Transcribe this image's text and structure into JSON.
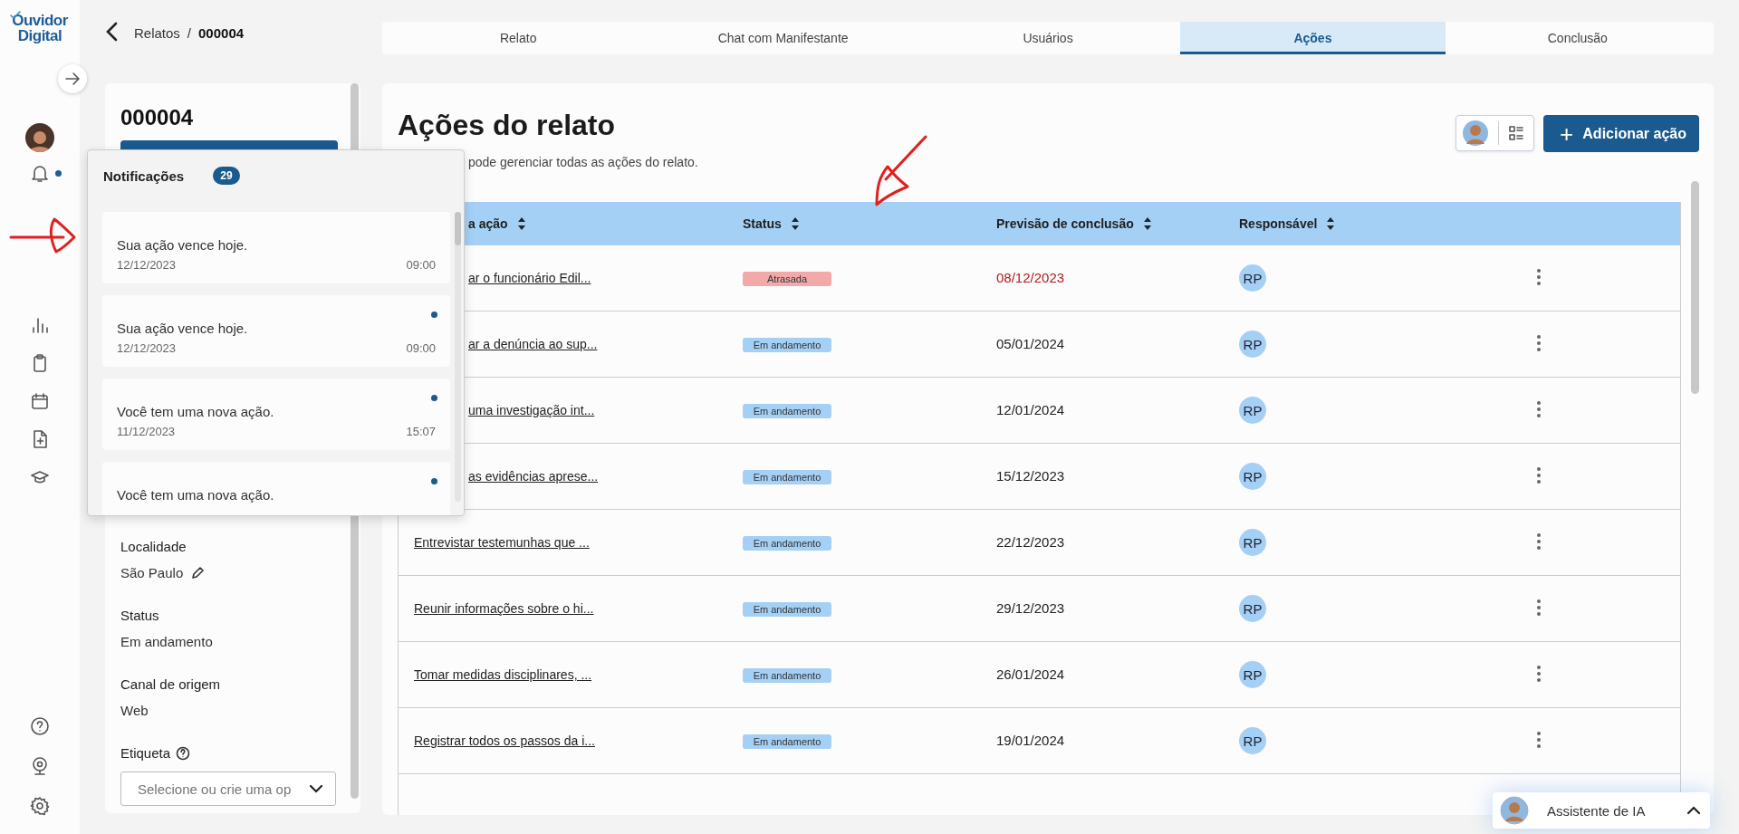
{
  "rail": {
    "logo": "Ouvidor Digital",
    "bell_unread": true
  },
  "breadcrumb": {
    "parent": "Relatos",
    "separator": "/",
    "current": "000004"
  },
  "tabs": [
    {
      "label": "Relato",
      "selected": false
    },
    {
      "label": "Chat com Manifestante",
      "selected": false
    },
    {
      "label": "Usuários",
      "selected": false
    },
    {
      "label": "Ações",
      "selected": true
    },
    {
      "label": "Conclusão",
      "selected": false
    }
  ],
  "case_card": {
    "title": "000004",
    "fields": [
      {
        "label": "Localidade",
        "value": "São Paulo",
        "editable": true
      },
      {
        "label": "Status",
        "value": "Em andamento"
      },
      {
        "label": "Canal de origem",
        "value": "Web"
      }
    ],
    "tag_field": {
      "label": "Etiqueta",
      "placeholder": "Selecione ou crie uma op"
    }
  },
  "notifications": {
    "title": "Notificações",
    "count": "29",
    "items": [
      {
        "text": "Sua ação vence hoje.",
        "date": "12/12/2023",
        "time": "09:00",
        "unread": false
      },
      {
        "text": "Sua ação vence hoje.",
        "date": "12/12/2023",
        "time": "09:00",
        "unread": true
      },
      {
        "text": "Você tem uma nova ação.",
        "date": "11/12/2023",
        "time": "15:07",
        "unread": true
      },
      {
        "text": "Você tem uma nova ação.",
        "unread": true
      }
    ]
  },
  "actions_panel": {
    "title": "Ações do relato",
    "subtitle": "pode gerenciar todas as ações do relato.",
    "add_button": "Adicionar ação",
    "add_button_icon": "+",
    "columns": [
      "a ação",
      "Status",
      "Previsão de conclusão",
      "Responsável"
    ],
    "rows": [
      {
        "action": "ar o funcionário Edil...",
        "status": "Atrasada",
        "overdue": true,
        "due": "08/12/2023",
        "assignee": "RP"
      },
      {
        "action": "ar a denúncia ao sup...",
        "status": "Em andamento",
        "overdue": false,
        "due": "05/01/2024",
        "assignee": "RP"
      },
      {
        "action": "uma investigação int...",
        "status": "Em andamento",
        "overdue": false,
        "due": "12/01/2024",
        "assignee": "RP"
      },
      {
        "action": "as evidências aprese...",
        "status": "Em andamento",
        "overdue": false,
        "due": "15/12/2023",
        "assignee": "RP"
      },
      {
        "action": "Entrevistar testemunhas que ...",
        "status": "Em andamento",
        "overdue": false,
        "due": "22/12/2023",
        "assignee": "RP"
      },
      {
        "action": "Reunir informações sobre o hi...",
        "status": "Em andamento",
        "overdue": false,
        "due": "29/12/2023",
        "assignee": "RP"
      },
      {
        "action": "Tomar medidas disciplinares, ...",
        "status": "Em andamento",
        "overdue": false,
        "due": "26/01/2024",
        "assignee": "RP"
      },
      {
        "action": "Registrar todos os passos da i...",
        "status": "Em andamento",
        "overdue": false,
        "due": "19/01/2024",
        "assignee": "RP"
      }
    ]
  },
  "assistant": {
    "label": "Assistente de IA"
  }
}
